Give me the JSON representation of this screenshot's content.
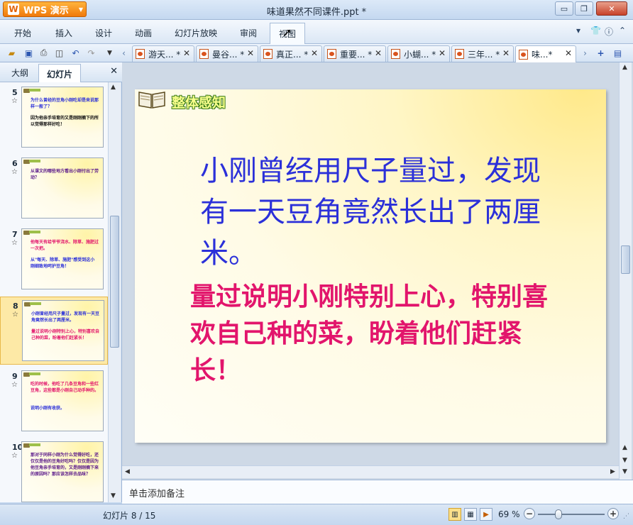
{
  "app": {
    "name": "WPS 演示",
    "window_title": "味道果然不同课件.ppt *"
  },
  "window_controls": {
    "minimize": "▭",
    "restore": "❐",
    "close": "✕"
  },
  "menu": {
    "items": [
      "开始",
      "插入",
      "设计",
      "动画",
      "幻灯片放映",
      "审阅",
      "视图"
    ],
    "active_index": 6,
    "right_icons": [
      "shirt-icon",
      "help-icon"
    ]
  },
  "doc_tabs": [
    {
      "label": "游天... *",
      "active": false
    },
    {
      "label": "曼谷... *",
      "active": false
    },
    {
      "label": "真正... *",
      "active": false
    },
    {
      "label": "重要... *",
      "active": false
    },
    {
      "label": "小蝴... *",
      "active": false
    },
    {
      "label": "三年... *",
      "active": false
    },
    {
      "label": "味...*",
      "active": true
    }
  ],
  "left_panel": {
    "tabs": [
      "大纲",
      "幻灯片"
    ],
    "active_tab": 1
  },
  "thumbnails": [
    {
      "num": "5",
      "selected": false,
      "lines": [
        {
          "text": "为什么曾经的豆角小刚吃却是来说那样一般了？",
          "color": "#2b30d9"
        },
        {
          "text": "因为他亲手培育的又是刚刚摘下的所以觉得那样好吃！",
          "color": "#111111"
        }
      ]
    },
    {
      "num": "6",
      "selected": false,
      "lines": [
        {
          "text": "从课文的哪些地方看出小刚付出了劳动？",
          "color": "#5a1a8a"
        }
      ]
    },
    {
      "num": "7",
      "selected": false,
      "lines": [
        {
          "text": "他每天有给爷爷浇水、除草、施肥过一次把。",
          "color": "#e2156c"
        },
        {
          "text": "从\"每天、除草、施肥\"感受到这小刚细致地呵护豆角！",
          "color": "#2b30d9"
        }
      ]
    },
    {
      "num": "8",
      "selected": true,
      "lines": [
        {
          "text": "小刚曾经用尺子量过，发现有一天豆角竟然长出了两厘米。",
          "color": "#2b30d9"
        },
        {
          "text": "量过说明小刚特别上心，特别喜欢自己种的菜，盼着他们赶紧长！",
          "color": "#e2156c"
        }
      ]
    },
    {
      "num": "9",
      "selected": false,
      "lines": [
        {
          "text": "吃的时候，他吃了几条豆角和一些红豆角，这些都是小刚自己动手种的。",
          "color": "#e2156c"
        },
        {
          "text": "说明小刚有收获。",
          "color": "#2b30d9"
        }
      ]
    },
    {
      "num": "10",
      "selected": false,
      "lines": [
        {
          "text": "那对于同样小刚为什么觉得好吃，还仅仅是他的豆角好吃吗？仅仅是因为他豆角亲手培育的，又是刚刚摘下来的原因吗？那应该怎样去品味？",
          "color": "#5a1a8a"
        }
      ]
    }
  ],
  "slide": {
    "heading": "整体感知",
    "para1": "小刚曾经用尺子量过，发现有一天豆角竟然长出了两厘米。",
    "para2": "量过说明小刚特别上心，特别喜欢自己种的菜，盼着他们赶紧长！",
    "para1_color": "#2b30d9",
    "para2_color": "#e2156c"
  },
  "notes": {
    "placeholder": "单击添加备注"
  },
  "status": {
    "slide_counter": "幻灯片 8 / 15",
    "zoom": "69 %",
    "zoom_percent": 69
  }
}
